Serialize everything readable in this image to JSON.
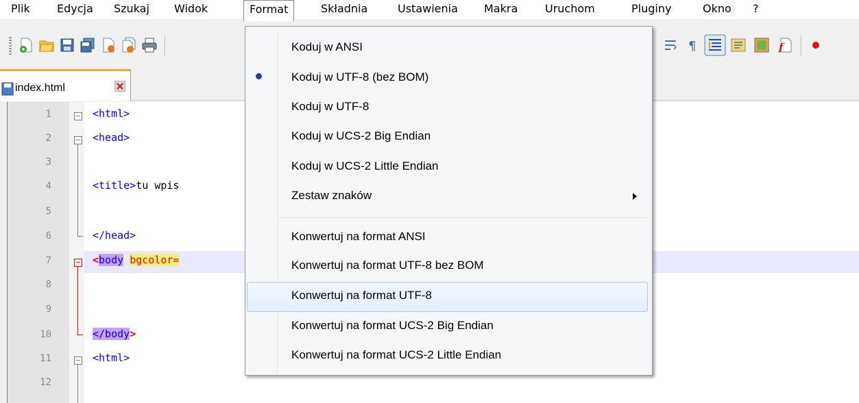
{
  "menubar": {
    "items": [
      "Plik",
      "Edycja",
      "Szukaj",
      "Widok",
      "Format",
      "Składnia",
      "Ustawienia",
      "Makra",
      "Uruchom",
      "Pluginy",
      "Okno",
      "?"
    ]
  },
  "tab": {
    "label": "index.html"
  },
  "editor": {
    "line_numbers": [
      "1",
      "2",
      "3",
      "4",
      "5",
      "6",
      "7",
      "8",
      "9",
      "10",
      "11",
      "12"
    ],
    "lines": {
      "l1": "<html>",
      "l2": "<head>",
      "l4_tag": "<title>",
      "l4_text": "tu wpis",
      "l6": "</head>",
      "l7_tag_open": "<",
      "l7_tag": "body",
      "l7_attr": "bgcolor=",
      "l10_tag": "</body",
      "l10_end": ">",
      "l11": "<html>"
    }
  },
  "format_menu": {
    "encode_items": [
      {
        "label": "Koduj w ANSI",
        "checked": false
      },
      {
        "label": "Koduj w UTF-8 (bez BOM)",
        "checked": true
      },
      {
        "label": "Koduj w UTF-8",
        "checked": false
      },
      {
        "label": "Koduj w UCS-2 Big Endian",
        "checked": false
      },
      {
        "label": "Koduj w UCS-2 Little Endian",
        "checked": false
      },
      {
        "label": "Zestaw znaków",
        "submenu": true
      }
    ],
    "convert_items": [
      {
        "label": "Konwertuj na format ANSI"
      },
      {
        "label": "Konwertuj na format UTF-8 bez BOM"
      },
      {
        "label": "Konwertuj na format UTF-8",
        "hovered": true
      },
      {
        "label": "Konwertuj na format UCS-2 Big Endian"
      },
      {
        "label": "Konwertuj na format UCS-2 Little Endian"
      }
    ]
  },
  "colors": {
    "tag": "#0000ff",
    "attribute": "#ff0000",
    "menu_hover_border": "#a9c8ef",
    "tab_accent": "#f4a542"
  }
}
